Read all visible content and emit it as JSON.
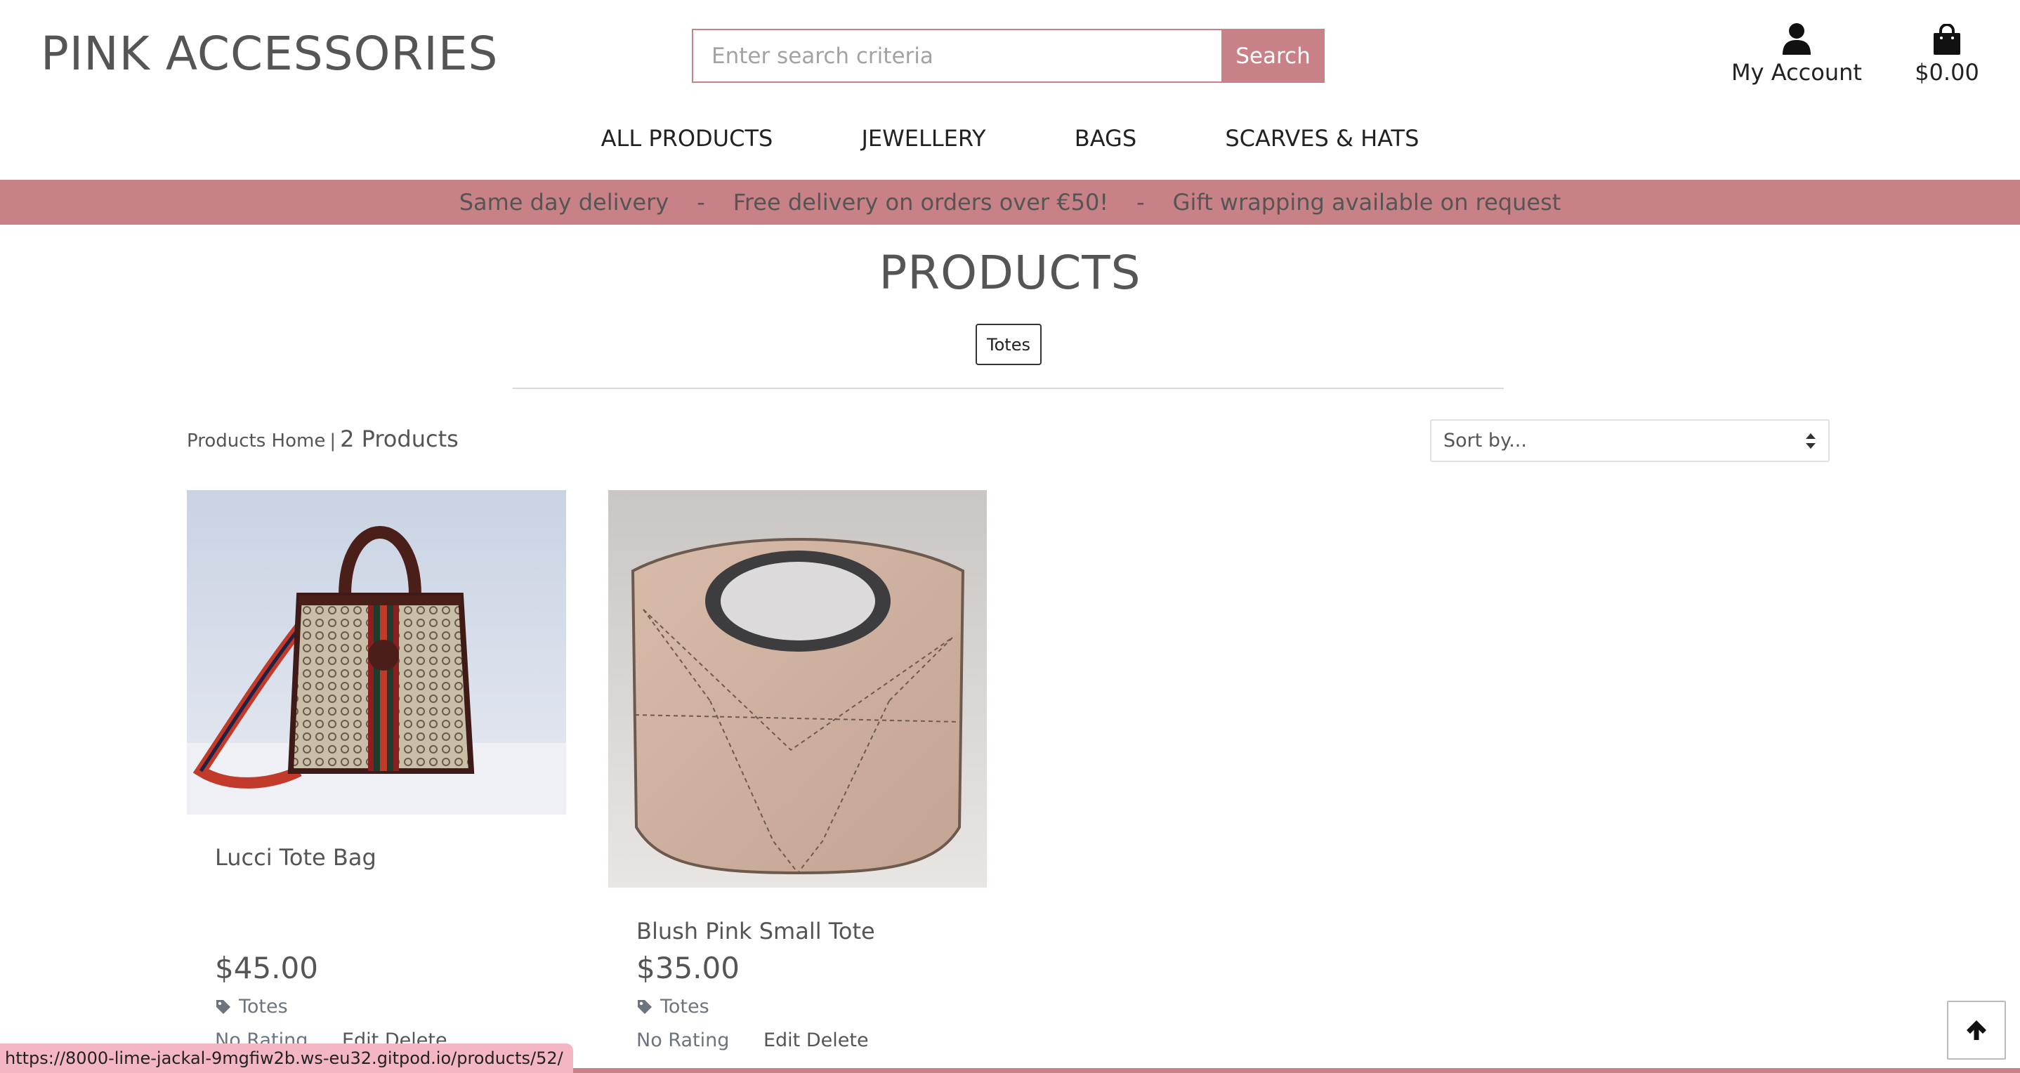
{
  "header": {
    "brand": "PINK ACCESSORIES",
    "search": {
      "placeholder": "Enter search criteria",
      "button_label": "Search"
    },
    "account": {
      "icon": "user-icon",
      "label": "My Account"
    },
    "cart": {
      "icon": "shopping-bag-icon",
      "total": "$0.00"
    }
  },
  "nav": {
    "items": [
      {
        "label": "ALL PRODUCTS"
      },
      {
        "label": "JEWELLERY"
      },
      {
        "label": "BAGS"
      },
      {
        "label": "SCARVES & HATS"
      }
    ]
  },
  "banner": {
    "messages": [
      "Same day delivery",
      "Free delivery on orders over €50!",
      "Gift wrapping available on request"
    ],
    "separator": "-"
  },
  "page": {
    "title": "PRODUCTS",
    "category_badge": "Totes",
    "products_home": "Products Home",
    "pipe": "|",
    "count": "2 Products",
    "sort_placeholder": "Sort by..."
  },
  "products": [
    {
      "name": "Lucci Tote Bag",
      "price": "$45.00",
      "category": "Totes",
      "rating": "No Rating",
      "edit": "Edit",
      "delete": "Delete",
      "image": "brown-patterned-tote-with-red-striped-strap"
    },
    {
      "name": "Blush Pink Small Tote",
      "price": "$35.00",
      "category": "Totes",
      "rating": "No Rating",
      "edit": "Edit",
      "delete": "Delete",
      "image": "blush-pink-leather-tote-with-round-handle"
    }
  ],
  "status_bar": {
    "url": "https://8000-lime-jackal-9mgfiw2b.ws-eu32.gitpod.io/products/52/"
  },
  "back_to_top": {
    "icon": "arrow-up-icon"
  },
  "colors": {
    "accent": "#c78187",
    "text": "#555555",
    "status_bar": "#f4b6c2"
  }
}
